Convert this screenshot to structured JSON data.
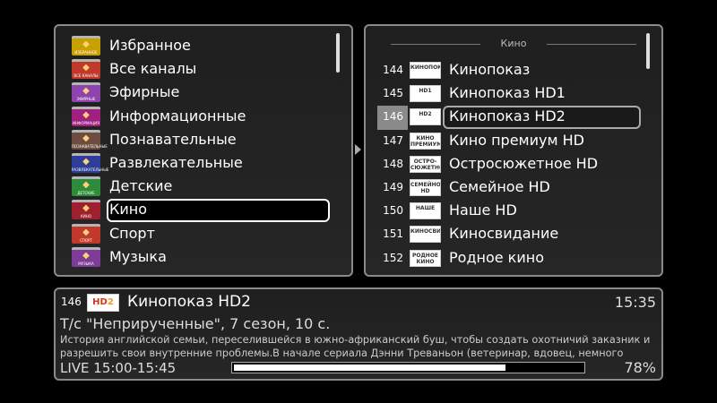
{
  "categories": {
    "items": [
      {
        "label": "Избранное",
        "icon": "star-icon",
        "color": "#c8a000",
        "caption": "ИЗБРАННОЕ"
      },
      {
        "label": "Все каналы",
        "icon": "globe-icon",
        "color": "#c0392b",
        "caption": "ВСЕ КАНАЛЫ"
      },
      {
        "label": "Эфирные",
        "icon": "antenna-icon",
        "color": "#8e44ad",
        "caption": "ЭФИРНЫЕ"
      },
      {
        "label": "Информационные",
        "icon": "news-icon",
        "color": "#a02080",
        "caption": "ИНФОРМАЦИЯ"
      },
      {
        "label": "Познавательные",
        "icon": "book-icon",
        "color": "#6d4c41",
        "caption": "ПОЗНАВАТЕЛЬНЫЕ"
      },
      {
        "label": "Развлекательные",
        "icon": "entertainment-icon",
        "color": "#2c3e9a",
        "caption": "РАЗВЛЕКАТЕЛЬНЫЕ"
      },
      {
        "label": "Детские",
        "icon": "kids-icon",
        "color": "#2e8b3a",
        "caption": "ДЕТСКИЕ"
      },
      {
        "label": "Кино",
        "icon": "film-icon",
        "color": "#a02030",
        "caption": "КИНО"
      },
      {
        "label": "Спорт",
        "icon": "sport-icon",
        "color": "#c0392b",
        "caption": "СПОРТ"
      },
      {
        "label": "Музыка",
        "icon": "music-icon",
        "color": "#7d3c98",
        "caption": "МУЗЫКА"
      }
    ],
    "selected_index": 7
  },
  "channels": {
    "group_title": "Кино",
    "items": [
      {
        "number": "144",
        "name": "Кинопоказ",
        "logo": "КИНОПОКАЗ"
      },
      {
        "number": "145",
        "name": "Кинопоказ HD1",
        "logo": "HD1"
      },
      {
        "number": "146",
        "name": "Кинопоказ HD2",
        "logo": "HD2"
      },
      {
        "number": "147",
        "name": "Кино премиум HD",
        "logo": "КИНО ПРЕМИУМ"
      },
      {
        "number": "148",
        "name": "Остросюжетное HD",
        "logo": "ОСТРО-СЮЖЕТНОЕ"
      },
      {
        "number": "149",
        "name": "Семейное HD",
        "logo": "СЕМЕЙНОЕ HD"
      },
      {
        "number": "150",
        "name": "Наше HD",
        "logo": "НАШЕ"
      },
      {
        "number": "151",
        "name": "Киносвидание",
        "logo": "КИНОСВИДАНИЕ"
      },
      {
        "number": "152",
        "name": "Родное кино",
        "logo": "РОДНОЕ КИНО"
      }
    ],
    "selected_index": 2
  },
  "info": {
    "number": "146",
    "channel_name": "Кинопоказ HD2",
    "time": "15:35",
    "program_title": "Т/с \"Неприрученные\", 7 сезон, 10 с.",
    "description": "История английской семьи, переселившейся в южно-африканский буш, чтобы создать охотничий заказник и разрешить свои внутренние проблемы.В начале сериала Дэнни Треваньон (ветеринар, вдовец, немного",
    "live_label": "LIVE 15:00-15:45",
    "progress_percent": 78,
    "progress_label": "78%"
  }
}
